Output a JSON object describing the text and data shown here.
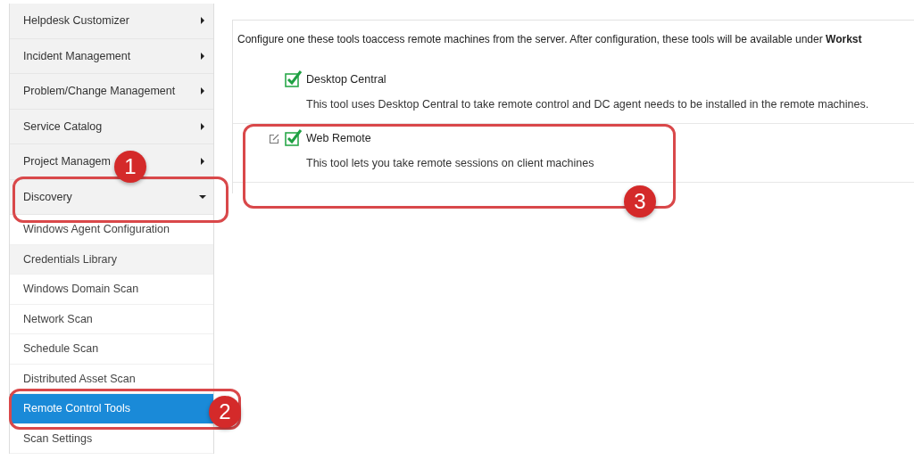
{
  "sidebar": {
    "items": [
      {
        "label": "Helpdesk Customizer",
        "kind": "submenu",
        "expanded": false
      },
      {
        "label": "Incident Management",
        "kind": "submenu",
        "expanded": false
      },
      {
        "label": "Problem/Change Management",
        "kind": "submenu",
        "expanded": false
      },
      {
        "label": "Service Catalog",
        "kind": "submenu",
        "expanded": false
      },
      {
        "label": "Project Managem",
        "kind": "submenu",
        "expanded": false
      },
      {
        "label": "Discovery",
        "kind": "submenu",
        "expanded": true,
        "children": [
          {
            "label": "Windows Agent Configuration",
            "selected": false,
            "hovered": false
          },
          {
            "label": "Credentials Library",
            "selected": false,
            "hovered": true
          },
          {
            "label": "Windows Domain Scan",
            "selected": false,
            "hovered": false
          },
          {
            "label": "Network Scan",
            "selected": false,
            "hovered": false
          },
          {
            "label": "Schedule Scan",
            "selected": false,
            "hovered": false
          },
          {
            "label": "Distributed Asset Scan",
            "selected": false,
            "hovered": false
          },
          {
            "label": "Remote Control Tools",
            "selected": true,
            "hovered": false
          },
          {
            "label": "Scan Settings",
            "selected": false,
            "hovered": false
          }
        ]
      }
    ]
  },
  "content": {
    "intro": "Configure one these tools toaccess remote machines from the server. After configuration, these tools will be available under **Workst**",
    "tools": [
      {
        "name": "Desktop Central",
        "description": "This tool uses Desktop Central to take remote control and DC agent needs to be installed in the remote machines.",
        "checked": true,
        "editable": false
      },
      {
        "name": "Web Remote",
        "description": "This tool lets you take remote sessions on client machines",
        "checked": true,
        "editable": true
      }
    ]
  },
  "annotations": [
    {
      "number": "1"
    },
    {
      "number": "2"
    },
    {
      "number": "3"
    }
  ]
}
